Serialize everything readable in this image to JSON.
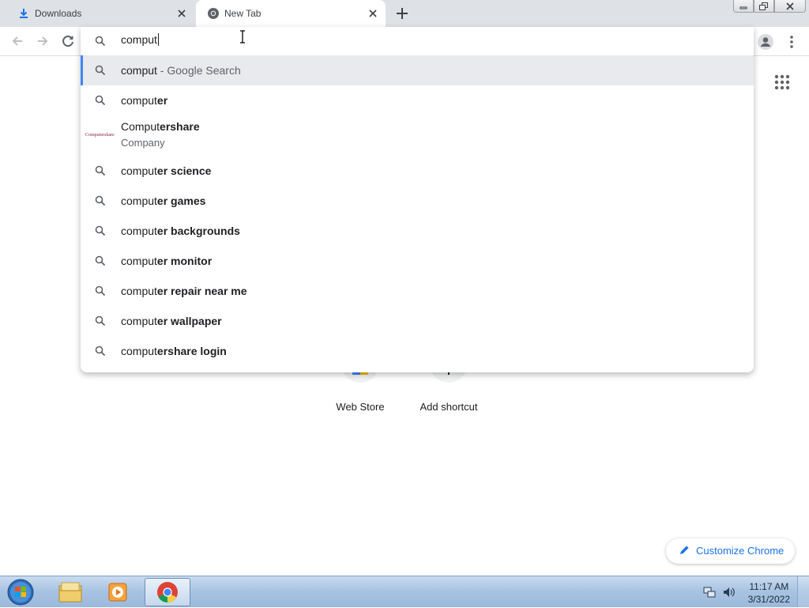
{
  "tabs": [
    {
      "title": "Downloads",
      "icon": "download-icon"
    },
    {
      "title": "New Tab",
      "icon": "chrome-icon"
    }
  ],
  "toolbar": {
    "back_icon": "back-arrow-icon",
    "forward_icon": "forward-arrow-icon",
    "reload_icon": "reload-icon",
    "profile_icon": "profile-icon",
    "menu_icon": "menu-dots-icon"
  },
  "omnibox": {
    "value": "comput",
    "suggestions": [
      {
        "typed": "comput",
        "rest": "",
        "suffix": " - Google Search",
        "selected": true
      },
      {
        "typed": "comput",
        "rest": "er"
      },
      {
        "typed": "Comput",
        "rest": "ershare",
        "subtitle": "Company",
        "logo_text": "Computershare",
        "entity": true
      },
      {
        "typed": "comput",
        "rest": "er science"
      },
      {
        "typed": "comput",
        "rest": "er games"
      },
      {
        "typed": "comput",
        "rest": "er backgrounds"
      },
      {
        "typed": "comput",
        "rest": "er monitor"
      },
      {
        "typed": "comput",
        "rest": "er repair near me"
      },
      {
        "typed": "comput",
        "rest": "er wallpaper"
      },
      {
        "typed": "comput",
        "rest": "ershare login"
      }
    ]
  },
  "ntp": {
    "shortcuts": [
      {
        "label": "Web Store"
      },
      {
        "label": "Add shortcut"
      }
    ],
    "customize_label": "Customize Chrome"
  },
  "taskbar": {
    "apps": [
      "windows-explorer-icon",
      "media-player-icon",
      "chrome-icon"
    ],
    "time": "11:17 AM",
    "date": "3/31/2022"
  },
  "colors": {
    "accent": "#1a73e8",
    "selection_bar": "#4285f4",
    "tabstrip": "#dee1e6"
  }
}
